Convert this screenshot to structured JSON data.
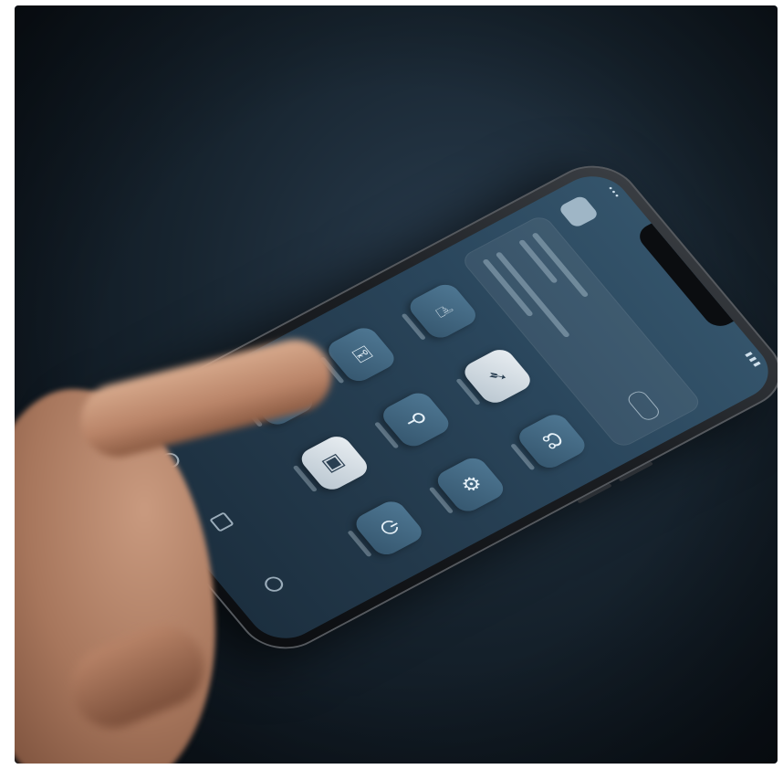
{
  "scene": {
    "description_colors": {
      "background": "#17242f",
      "screen": "#2a465c",
      "tile": "#4f7894",
      "skin": "#b98468"
    }
  },
  "phone": {
    "icons": [
      "app-logo-icon",
      "toggle-icon",
      "tap-icon",
      "cursor-icon",
      "headset-icon",
      "lock-icon",
      "share-icon",
      "tool-icon",
      "app-icon",
      "settings-icon",
      "power-icon"
    ],
    "dock_icons": [
      "home-circle-icon",
      "apps-icon",
      "settings-icon"
    ]
  }
}
